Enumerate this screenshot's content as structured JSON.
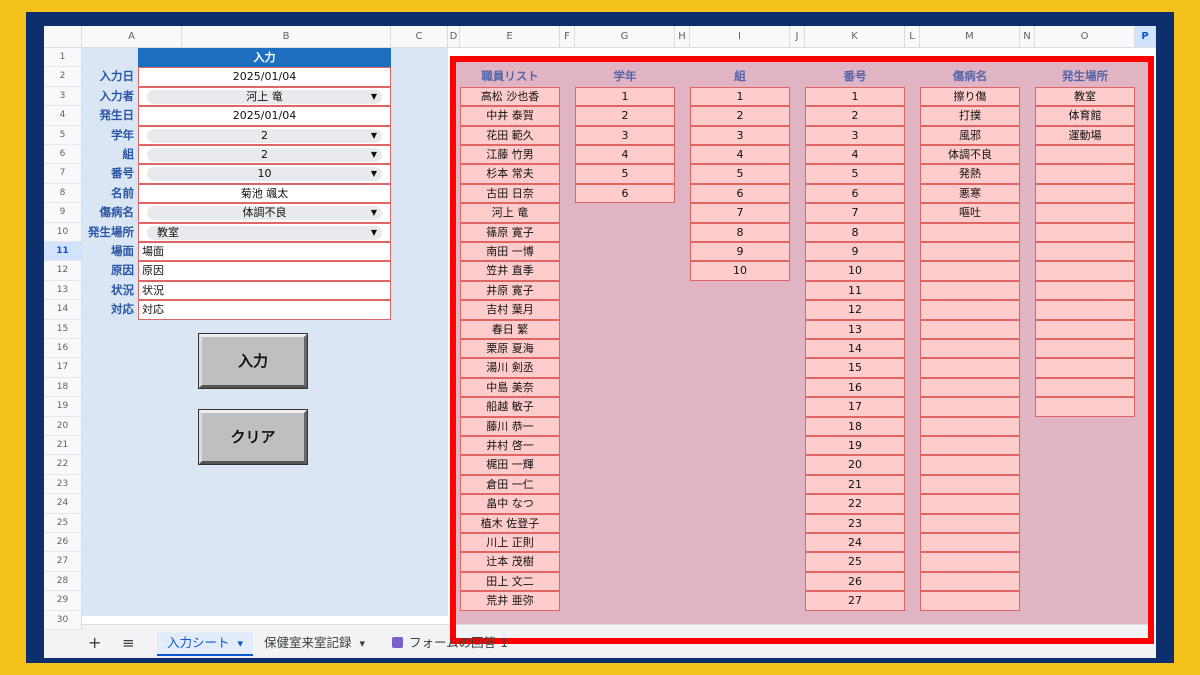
{
  "columns": [
    "A",
    "B",
    "C",
    "D",
    "E",
    "F",
    "G",
    "H",
    "I",
    "J",
    "K",
    "L",
    "M",
    "N",
    "O",
    "P"
  ],
  "selected_column": "P",
  "rows": [
    "1",
    "2",
    "3",
    "4",
    "5",
    "6",
    "7",
    "8",
    "9",
    "10",
    "11",
    "12",
    "13",
    "14",
    "15",
    "16",
    "17",
    "18",
    "19",
    "20",
    "21",
    "22",
    "23",
    "24",
    "25",
    "26",
    "27",
    "28",
    "29",
    "30"
  ],
  "selected_row": "11",
  "form": {
    "header": "入力",
    "fields": [
      {
        "label": "入力日",
        "value": "2025/01/04",
        "dropdown": false
      },
      {
        "label": "入力者",
        "value": "河上 竜",
        "dropdown": true
      },
      {
        "label": "発生日",
        "value": "2025/01/04",
        "dropdown": false
      },
      {
        "label": "学年",
        "value": "2",
        "dropdown": true
      },
      {
        "label": "組",
        "value": "2",
        "dropdown": true
      },
      {
        "label": "番号",
        "value": "10",
        "dropdown": true
      },
      {
        "label": "名前",
        "value": "菊池 颯太",
        "dropdown": false
      },
      {
        "label": "傷病名",
        "value": "体調不良",
        "dropdown": true
      },
      {
        "label": "発生場所",
        "value": "教室",
        "dropdown": true,
        "align": "left"
      },
      {
        "label": "場面",
        "value": "場面",
        "dropdown": false,
        "align": "left"
      },
      {
        "label": "原因",
        "value": "原因",
        "dropdown": false,
        "align": "left"
      },
      {
        "label": "状況",
        "value": "状況",
        "dropdown": false,
        "align": "left"
      },
      {
        "label": "対応",
        "value": "対応",
        "dropdown": false,
        "align": "left"
      }
    ],
    "dropdown_arrow": "▼",
    "buttons": {
      "input": "入力",
      "clear": "クリア"
    }
  },
  "lists": [
    {
      "header": "職員リスト",
      "items": [
        "高松 沙也香",
        "中井 泰賀",
        "花田 範久",
        "江藤 竹男",
        "杉本 常夫",
        "古田 日奈",
        "河上 竜",
        "篠原 寛子",
        "南田 一博",
        "笠井 直季",
        "井原 寛子",
        "吉村 葉月",
        "春日 繁",
        "栗原 夏海",
        "湯川 剣丞",
        "中島 美奈",
        "船越 敏子",
        "藤川 恭一",
        "井村 啓一",
        "梶田 一輝",
        "倉田 一仁",
        "畠中 なつ",
        "植木 佐登子",
        "川上 正則",
        "辻本 茂樹",
        "田上 文二",
        "荒井 亜弥"
      ],
      "empty": 0
    },
    {
      "header": "学年",
      "items": [
        "1",
        "2",
        "3",
        "4",
        "5",
        "6"
      ],
      "empty": 0
    },
    {
      "header": "組",
      "items": [
        "1",
        "2",
        "3",
        "4",
        "5",
        "6",
        "7",
        "8",
        "9",
        "10"
      ],
      "empty": 0
    },
    {
      "header": "番号",
      "items": [
        "1",
        "2",
        "3",
        "4",
        "5",
        "6",
        "7",
        "8",
        "9",
        "10",
        "11",
        "12",
        "13",
        "14",
        "15",
        "16",
        "17",
        "18",
        "19",
        "20",
        "21",
        "22",
        "23",
        "24",
        "25",
        "26",
        "27"
      ],
      "empty": 0
    },
    {
      "header": "傷病名",
      "items": [
        "擦り傷",
        "打撲",
        "風邪",
        "体調不良",
        "発熱",
        "悪寒",
        "嘔吐"
      ],
      "empty": 20
    },
    {
      "header": "発生場所",
      "items": [
        "教室",
        "体育館",
        "運動場"
      ],
      "empty": 14
    }
  ],
  "sheet_tabs": {
    "add_icon": "+",
    "menu_icon": "≡",
    "tabs": [
      {
        "label": "入力シート",
        "arrow": "▾",
        "active": true
      },
      {
        "label": "保健室来室記録",
        "arrow": "▾",
        "active": false
      },
      {
        "label": "フォームの回答 1",
        "arrow": "",
        "active": false
      }
    ]
  },
  "colors": {
    "highlight": "#ff0000",
    "header_blue": "#1f6fc0",
    "list_cell": "#ffcccc"
  }
}
